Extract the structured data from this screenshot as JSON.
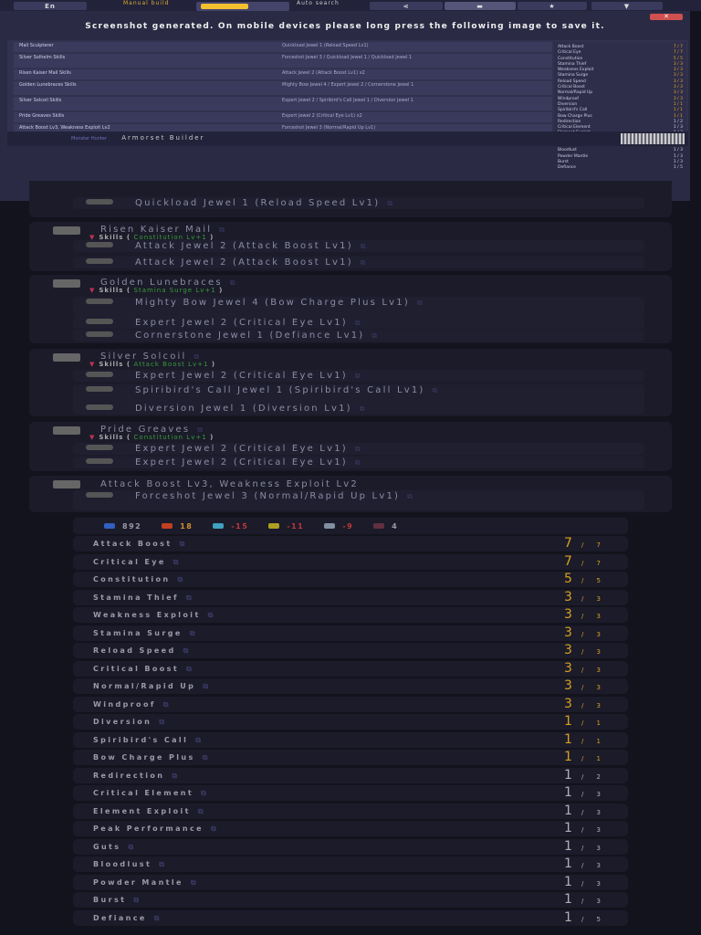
{
  "topbar": {
    "language": "En",
    "manual_label": "Manual build",
    "auto_label": "Auto search",
    "icons": [
      "share-icon",
      "camera-icon",
      "star-icon",
      "filter-icon"
    ]
  },
  "overlay": {
    "close": "✕",
    "title": "Screenshot generated. On mobile devices please long press the following image to save it.",
    "footer_title": "Armorset Builder",
    "footer_logo": "Monster Hunter",
    "mini_items": [
      {
        "name": "Mail Sculpterer",
        "jewels": "Quickload Jewel 1 (Reload Speed Lv1)"
      },
      {
        "name": "Silver Solhelm  Skills",
        "jewels": "Forceshot Jewel 3 / Quickload Jewel 1 / Quickload Jewel 1"
      },
      {
        "name": "Risen Kaiser Mail  Skills",
        "jewels": "Attack Jewel 2 (Attack Boost Lv1) x2"
      },
      {
        "name": "Golden Lunebraces  Skills",
        "jewels": "Mighty Bow Jewel 4 / Expert Jewel 2 / Cornerstone Jewel 1"
      },
      {
        "name": "Silver Solcoil  Skills",
        "jewels": "Expert Jewel 2 / Spiribird's Call Jewel 1 / Diversion Jewel 1"
      },
      {
        "name": "Pride Greaves  Skills",
        "jewels": "Expert Jewel 2 (Critical Eye Lv1) x2"
      },
      {
        "name": "Attack Boost Lv3, Weakness Exploit Lv2",
        "jewels": "Forceshot Jewel 3 (Normal/Rapid Up Lv1)"
      }
    ]
  },
  "pieces": [
    {
      "name": "",
      "skill": "",
      "jewels": [
        "Quickload Jewel 1 (Reload Speed Lv1)"
      ]
    },
    {
      "name": "Risen Kaiser Mail",
      "skill": "Constitution Lv+1",
      "jewels": [
        "Attack Jewel 2 (Attack Boost Lv1)",
        "Attack Jewel 2 (Attack Boost Lv1)"
      ]
    },
    {
      "name": "Golden Lunebraces",
      "skill": "Stamina Surge Lv+1",
      "jewels": [
        "Mighty Bow Jewel 4 (Bow Charge Plus Lv1)",
        "Expert Jewel 2 (Critical Eye Lv1)",
        "Cornerstone Jewel 1 (Defiance Lv1)"
      ]
    },
    {
      "name": "Silver Solcoil",
      "skill": "Attack Boost Lv+1",
      "jewels": [
        "Expert Jewel 2 (Critical Eye Lv1)",
        "Spiribird's Call Jewel 1 (Spiribird's Call Lv1)",
        "Diversion Jewel 1 (Diversion Lv1)"
      ]
    },
    {
      "name": "Pride Greaves",
      "skill": "Constitution Lv+1",
      "jewels": [
        "Expert Jewel 2 (Critical Eye Lv1)",
        "Expert Jewel 2 (Critical Eye Lv1)"
      ]
    },
    {
      "name": "Attack Boost Lv3, Weakness Exploit Lv2",
      "skill": "",
      "jewels": [
        "Forceshot Jewel 3 (Normal/Rapid Up Lv1)"
      ]
    }
  ],
  "skills_label": "Skills",
  "stats": [
    {
      "icon": "defense-icon",
      "value": "892",
      "color": "#9a9aa8",
      "icolor": "#3060c0"
    },
    {
      "icon": "fire-icon",
      "value": "18",
      "color": "#d0902a",
      "icolor": "#c04020"
    },
    {
      "icon": "water-icon",
      "value": "-15",
      "color": "#c03838",
      "icolor": "#40a0c0"
    },
    {
      "icon": "thunder-icon",
      "value": "-11",
      "color": "#c03838",
      "icolor": "#b0a020"
    },
    {
      "icon": "ice-icon",
      "value": "-9",
      "color": "#c03838",
      "icolor": "#8090a0"
    },
    {
      "icon": "dragon-icon",
      "value": "4",
      "color": "#9a9aa8",
      "icolor": "#603040"
    }
  ],
  "skills": [
    {
      "name": "Attack Boost",
      "level": "7",
      "max": "7"
    },
    {
      "name": "Critical Eye",
      "level": "7",
      "max": "7"
    },
    {
      "name": "Constitution",
      "level": "5",
      "max": "5"
    },
    {
      "name": "Stamina Thief",
      "level": "3",
      "max": "3"
    },
    {
      "name": "Weakness Exploit",
      "level": "3",
      "max": "3"
    },
    {
      "name": "Stamina Surge",
      "level": "3",
      "max": "3"
    },
    {
      "name": "Reload Speed",
      "level": "3",
      "max": "3"
    },
    {
      "name": "Critical Boost",
      "level": "3",
      "max": "3"
    },
    {
      "name": "Normal/Rapid Up",
      "level": "3",
      "max": "3"
    },
    {
      "name": "Windproof",
      "level": "3",
      "max": "3"
    },
    {
      "name": "Diversion",
      "level": "1",
      "max": "1"
    },
    {
      "name": "Spiribird's Call",
      "level": "1",
      "max": "1"
    },
    {
      "name": "Bow Charge Plus",
      "level": "1",
      "max": "1"
    },
    {
      "name": "Redirection",
      "level": "1",
      "max": "2"
    },
    {
      "name": "Critical Element",
      "level": "1",
      "max": "3"
    },
    {
      "name": "Element Exploit",
      "level": "1",
      "max": "3"
    },
    {
      "name": "Peak Performance",
      "level": "1",
      "max": "3"
    },
    {
      "name": "Guts",
      "level": "1",
      "max": "3"
    },
    {
      "name": "Bloodlust",
      "level": "1",
      "max": "3"
    },
    {
      "name": "Powder Mantle",
      "level": "1",
      "max": "3"
    },
    {
      "name": "Burst",
      "level": "1",
      "max": "3"
    },
    {
      "name": "Defiance",
      "level": "1",
      "max": "5"
    }
  ],
  "colors": {
    "maxed": "#d8a020",
    "normal": "#b0b0b8"
  }
}
